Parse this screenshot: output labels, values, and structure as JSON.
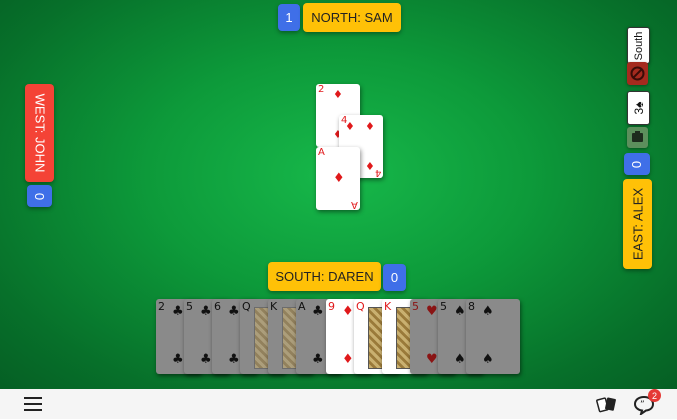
{
  "north": {
    "name": "NORTH: SAM",
    "score": "1"
  },
  "west": {
    "name": "WEST: JOHN",
    "score": "0"
  },
  "east": {
    "name": "EAST: ALEX",
    "score": "0"
  },
  "south": {
    "name": "SOUTH: DAREN",
    "score": "0"
  },
  "contract": {
    "declarer": "South",
    "level": "3",
    "suit_icon": "spade-icon"
  },
  "trick": [
    {
      "rank": "2",
      "suit": "♦",
      "seat": "north"
    },
    {
      "rank": "4",
      "suit": "♦",
      "seat": "east"
    },
    {
      "rank": "A",
      "suit": "♦",
      "seat": "south"
    }
  ],
  "hand": [
    {
      "rank": "2",
      "suit": "♣",
      "color": "black",
      "lit": false
    },
    {
      "rank": "5",
      "suit": "♣",
      "color": "black",
      "lit": false
    },
    {
      "rank": "6",
      "suit": "♣",
      "color": "black",
      "lit": false
    },
    {
      "rank": "Q",
      "suit": "♣",
      "color": "black",
      "lit": false,
      "face": true
    },
    {
      "rank": "K",
      "suit": "♣",
      "color": "black",
      "lit": false,
      "face": true
    },
    {
      "rank": "A",
      "suit": "♣",
      "color": "black",
      "lit": false
    },
    {
      "rank": "9",
      "suit": "♦",
      "color": "red",
      "lit": true
    },
    {
      "rank": "Q",
      "suit": "♦",
      "color": "red",
      "lit": true,
      "face": true
    },
    {
      "rank": "K",
      "suit": "♦",
      "color": "red",
      "lit": true,
      "face": true
    },
    {
      "rank": "5",
      "suit": "♥",
      "color": "red",
      "lit": false
    },
    {
      "rank": "5",
      "suit": "♠",
      "color": "black",
      "lit": false
    },
    {
      "rank": "8",
      "suit": "♠",
      "color": "black",
      "lit": false
    }
  ],
  "chat": {
    "unread": "2"
  },
  "icons": {
    "menu": "menu-icon",
    "cards": "cards-icon",
    "chat": "chat-icon"
  }
}
